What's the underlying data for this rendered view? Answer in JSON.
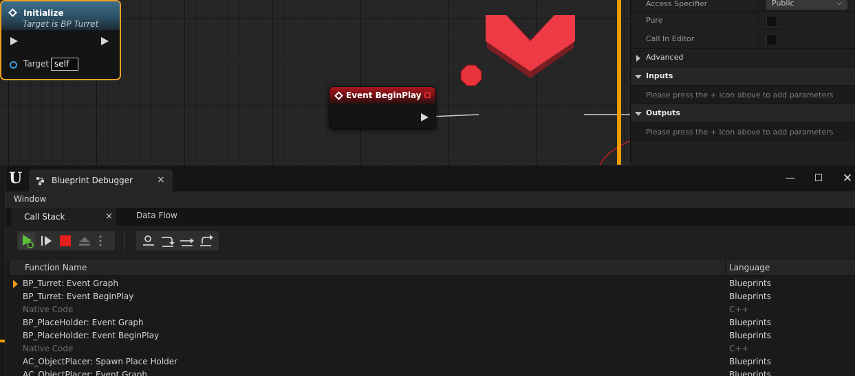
{
  "graph": {
    "event_node": {
      "title": "Event BeginPlay"
    },
    "function_node": {
      "title": "Initialize",
      "subtitle": "Target is BP Turret",
      "target_label": "Target",
      "target_value": "self"
    }
  },
  "details": {
    "access_specifier": {
      "label": "Access Specifier",
      "value": "Public"
    },
    "pure": {
      "label": "Pure"
    },
    "call_in_editor": {
      "label": "Call In Editor"
    },
    "advanced": {
      "label": "Advanced"
    },
    "inputs": {
      "label": "Inputs",
      "hint": "Please press the + icon above to add parameters"
    },
    "outputs": {
      "label": "Outputs",
      "hint": "Please press the + icon above to add parameters"
    }
  },
  "debugger": {
    "window_title": "Blueprint Debugger",
    "tab_close": "×",
    "menu": {
      "window": "Window"
    },
    "tabs": {
      "call_stack": "Call Stack",
      "call_stack_close": "×",
      "data_flow": "Data Flow"
    },
    "window_buttons": {
      "minimize": "—",
      "maximize": "☐",
      "close": "✕"
    },
    "columns": {
      "function_name": "Function Name",
      "language": "Language"
    },
    "rows": [
      {
        "fn": "BP_Turret: Event Graph",
        "lang": "Blueprints"
      },
      {
        "fn": "BP_Turret: Event BeginPlay",
        "lang": "Blueprints"
      },
      {
        "fn": "Native Code",
        "lang": "C++"
      },
      {
        "fn": "BP_PlaceHolder: Event Graph",
        "lang": "Blueprints"
      },
      {
        "fn": "BP_PlaceHolder: Event BeginPlay",
        "lang": "Blueprints"
      },
      {
        "fn": "Native Code",
        "lang": "C++"
      },
      {
        "fn": "AC_ObjectPlacer: Spawn Place Holder",
        "lang": "Blueprints"
      },
      {
        "fn": "AC_ObjectPlacer: Event Graph",
        "lang": "Blueprints"
      }
    ]
  },
  "colors": {
    "accent_orange": "#f29b00",
    "breakpoint_red": "#e8333a",
    "event_red": "#a8181e",
    "function_blue": "#3d6f8e",
    "resume_green": "#5cc23a"
  }
}
